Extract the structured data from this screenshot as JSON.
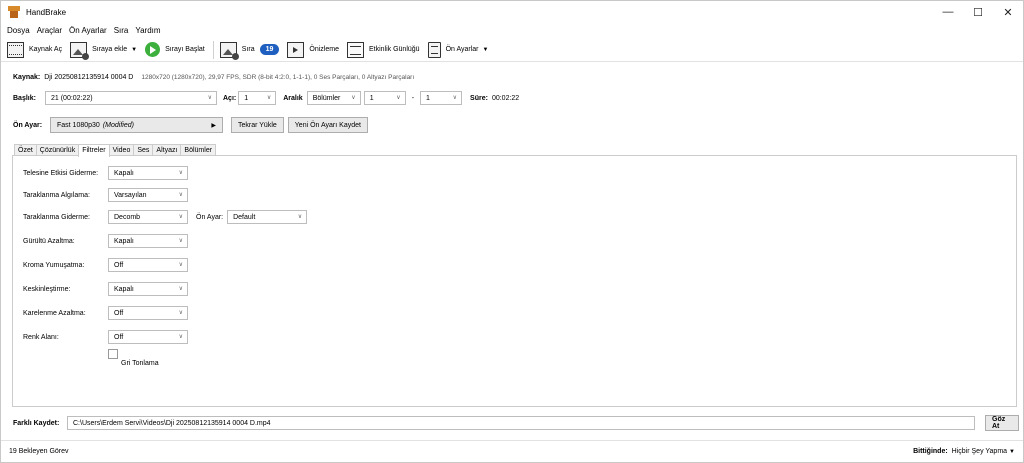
{
  "window": {
    "title": "HandBrake",
    "minimize": "—",
    "maximize": "☐",
    "close": "✕"
  },
  "menu": [
    "Dosya",
    "Araçlar",
    "Ön Ayarlar",
    "Sıra",
    "Yardım"
  ],
  "toolbar": {
    "open_source": "Kaynak Aç",
    "add_to_queue": "Sıraya ekle",
    "start_queue": "Sırayı Başlat",
    "queue": "Sıra",
    "queue_count": "19",
    "preview": "Önizleme",
    "activity_log": "Etkinlik Günlüğü",
    "presets": "Ön Ayarlar"
  },
  "source": {
    "label": "Kaynak:",
    "name": "Dji 20250812135914 0004 D",
    "details": "1280x720 (1280x720), 29,97 FPS, SDR (8-bit 4:2:0, 1-1-1), 0 Ses Parçaları, 0 Altyazı Parçaları"
  },
  "title_row": {
    "title_label": "Başlık:",
    "title_value": "21 (00:02:22)",
    "angle_label": "Açı:",
    "angle_value": "1",
    "range_label": "Aralık",
    "range_type": "Bölümler",
    "range_start": "1",
    "range_sep": "-",
    "range_end": "1",
    "duration_label": "Süre:",
    "duration_value": "00:02:22"
  },
  "preset_row": {
    "label": "Ön Ayar:",
    "value": "Fast 1080p30",
    "modified": "(Modified)",
    "reload": "Tekrar Yükle",
    "save_new": "Yeni Ön Ayarı Kaydet"
  },
  "tabs": [
    "Özet",
    "Çözünürlük",
    "Filtreler",
    "Video",
    "Ses",
    "Altyazı",
    "Bölümler"
  ],
  "filters": {
    "detelecine": {
      "label": "Telesine Etkisi Giderme:",
      "value": "Kapalı"
    },
    "comb_detect": {
      "label": "Taraklanma Algılama:",
      "value": "Varsayılan"
    },
    "deinterlace": {
      "label": "Taraklanma Giderme:",
      "value": "Decomb",
      "preset_label": "Ön Ayar:",
      "preset_value": "Default"
    },
    "denoise": {
      "label": "Gürültü Azaltma:",
      "value": "Kapalı"
    },
    "chroma_smooth": {
      "label": "Kroma Yumuşatma:",
      "value": "Off"
    },
    "sharpen": {
      "label": "Keskinleştirme:",
      "value": "Kapalı"
    },
    "deblock": {
      "label": "Karelenme Azaltma:",
      "value": "Off"
    },
    "colorspace": {
      "label": "Renk Alanı:",
      "value": "Off"
    },
    "grayscale": {
      "label": "Gri Tonlama"
    }
  },
  "save_as": {
    "label": "Farklı Kaydet:",
    "path": "C:\\Users\\Erdem Servi\\Videos\\Dji 20250812135914 0004 D.mp4",
    "browse": "Göz At"
  },
  "status": {
    "pending": "19 Bekleyen Görev",
    "when_done_label": "Bittiğinde:",
    "when_done_value": "Hiçbir Şey Yapma"
  },
  "colors": {
    "accent": "#1f5fbf",
    "play": "#3daf3d"
  }
}
